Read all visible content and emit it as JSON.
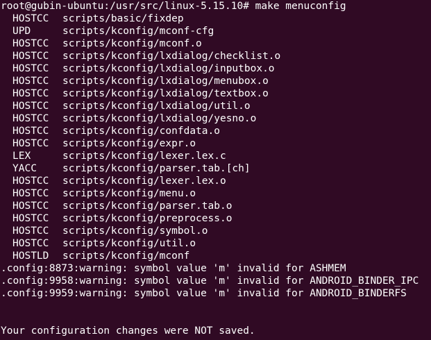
{
  "terminal": {
    "prompt_line": "root@gubin-ubuntu:/usr/src/linux-5.15.10# make menuconfig",
    "build_lines": [
      {
        "tag": "HOSTCC",
        "path": "scripts/basic/fixdep"
      },
      {
        "tag": "UPD",
        "path": "scripts/kconfig/mconf-cfg"
      },
      {
        "tag": "HOSTCC",
        "path": "scripts/kconfig/mconf.o"
      },
      {
        "tag": "HOSTCC",
        "path": "scripts/kconfig/lxdialog/checklist.o"
      },
      {
        "tag": "HOSTCC",
        "path": "scripts/kconfig/lxdialog/inputbox.o"
      },
      {
        "tag": "HOSTCC",
        "path": "scripts/kconfig/lxdialog/menubox.o"
      },
      {
        "tag": "HOSTCC",
        "path": "scripts/kconfig/lxdialog/textbox.o"
      },
      {
        "tag": "HOSTCC",
        "path": "scripts/kconfig/lxdialog/util.o"
      },
      {
        "tag": "HOSTCC",
        "path": "scripts/kconfig/lxdialog/yesno.o"
      },
      {
        "tag": "HOSTCC",
        "path": "scripts/kconfig/confdata.o"
      },
      {
        "tag": "HOSTCC",
        "path": "scripts/kconfig/expr.o"
      },
      {
        "tag": "LEX",
        "path": "scripts/kconfig/lexer.lex.c"
      },
      {
        "tag": "YACC",
        "path": "scripts/kconfig/parser.tab.[ch]"
      },
      {
        "tag": "HOSTCC",
        "path": "scripts/kconfig/lexer.lex.o"
      },
      {
        "tag": "HOSTCC",
        "path": "scripts/kconfig/menu.o"
      },
      {
        "tag": "HOSTCC",
        "path": "scripts/kconfig/parser.tab.o"
      },
      {
        "tag": "HOSTCC",
        "path": "scripts/kconfig/preprocess.o"
      },
      {
        "tag": "HOSTCC",
        "path": "scripts/kconfig/symbol.o"
      },
      {
        "tag": "HOSTCC",
        "path": "scripts/kconfig/util.o"
      },
      {
        "tag": "HOSTLD",
        "path": "scripts/kconfig/mconf"
      }
    ],
    "warnings": [
      ".config:8873:warning: symbol value 'm' invalid for ASHMEM",
      ".config:9958:warning: symbol value 'm' invalid for ANDROID_BINDER_IPC",
      ".config:9959:warning: symbol value 'm' invalid for ANDROID_BINDERFS"
    ],
    "final_message": "Your configuration changes were NOT saved."
  },
  "colors": {
    "background": "#300a24",
    "text": "#ffffff"
  }
}
